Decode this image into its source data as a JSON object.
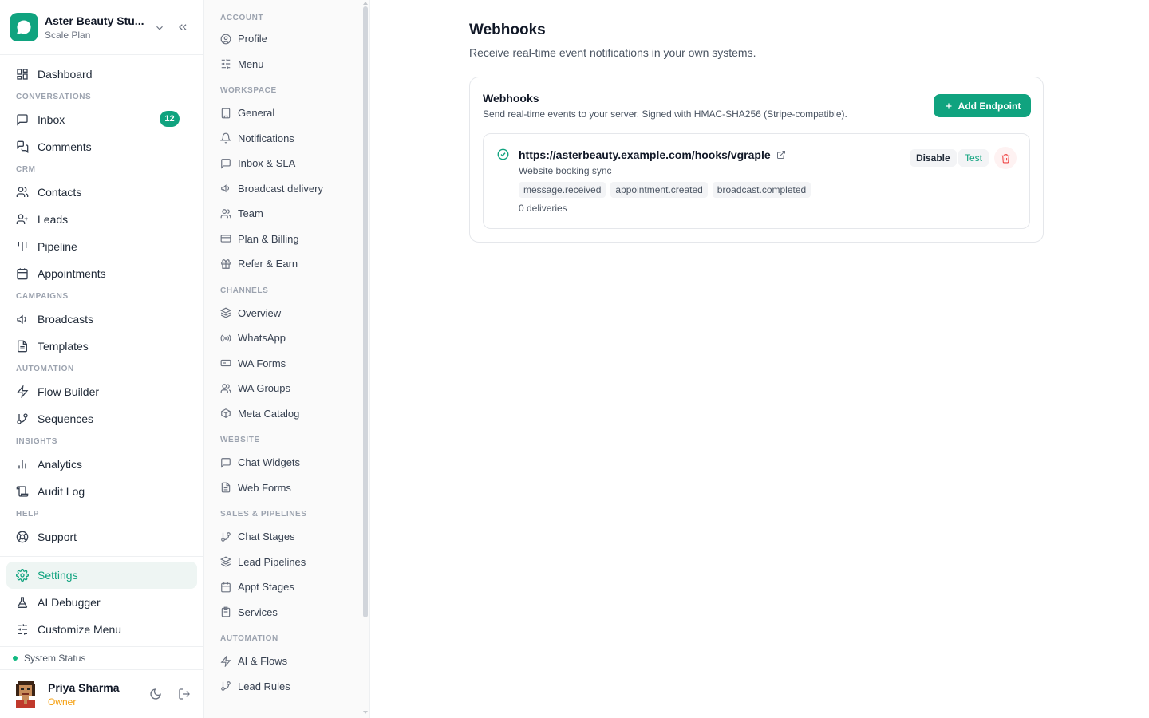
{
  "brand": {
    "name": "Aster Beauty Stu...",
    "plan": "Scale Plan"
  },
  "nav": {
    "dashboard": "Dashboard",
    "sec_conversations": "CONVERSATIONS",
    "inbox": "Inbox",
    "inbox_badge": "12",
    "comments": "Comments",
    "sec_crm": "CRM",
    "contacts": "Contacts",
    "leads": "Leads",
    "pipeline": "Pipeline",
    "appointments": "Appointments",
    "sec_campaigns": "CAMPAIGNS",
    "broadcasts": "Broadcasts",
    "templates": "Templates",
    "sec_automation": "AUTOMATION",
    "flow_builder": "Flow Builder",
    "sequences": "Sequences",
    "sec_insights": "INSIGHTS",
    "analytics": "Analytics",
    "audit_log": "Audit Log",
    "sec_help": "HELP",
    "support": "Support",
    "settings": "Settings",
    "ai_debugger": "AI Debugger",
    "customize_menu": "Customize Menu"
  },
  "status": {
    "label": "System Status"
  },
  "user": {
    "name": "Priya Sharma",
    "role": "Owner"
  },
  "settings_nav": {
    "sec_account": "ACCOUNT",
    "profile": "Profile",
    "menu": "Menu",
    "sec_workspace": "WORKSPACE",
    "general": "General",
    "notifications": "Notifications",
    "inbox_sla": "Inbox & SLA",
    "broadcast_delivery": "Broadcast delivery",
    "team": "Team",
    "plan_billing": "Plan & Billing",
    "refer_earn": "Refer & Earn",
    "sec_channels": "CHANNELS",
    "overview": "Overview",
    "whatsapp": "WhatsApp",
    "wa_forms": "WA Forms",
    "wa_groups": "WA Groups",
    "meta_catalog": "Meta Catalog",
    "sec_website": "WEBSITE",
    "chat_widgets": "Chat Widgets",
    "web_forms": "Web Forms",
    "sec_sales": "SALES & PIPELINES",
    "chat_stages": "Chat Stages",
    "lead_pipelines": "Lead Pipelines",
    "appt_stages": "Appt Stages",
    "services": "Services",
    "sec_automation": "AUTOMATION",
    "ai_flows": "AI & Flows",
    "lead_rules": "Lead Rules"
  },
  "main": {
    "title": "Webhooks",
    "subtitle": "Receive real-time event notifications in your own systems.",
    "card": {
      "title": "Webhooks",
      "description": "Send real-time events to your server. Signed with HMAC-SHA256 (Stripe-compatible).",
      "add_label": "Add Endpoint"
    },
    "endpoint": {
      "url": "https://asterbeauty.example.com/hooks/vgraple",
      "description": "Website booking sync",
      "events": [
        "message.received",
        "appointment.created",
        "broadcast.completed"
      ],
      "deliveries": "0 deliveries",
      "disable_label": "Disable",
      "test_label": "Test"
    }
  },
  "colors": {
    "accent": "#10a37f",
    "danger": "#ef4444",
    "owner": "#f59e0b"
  }
}
